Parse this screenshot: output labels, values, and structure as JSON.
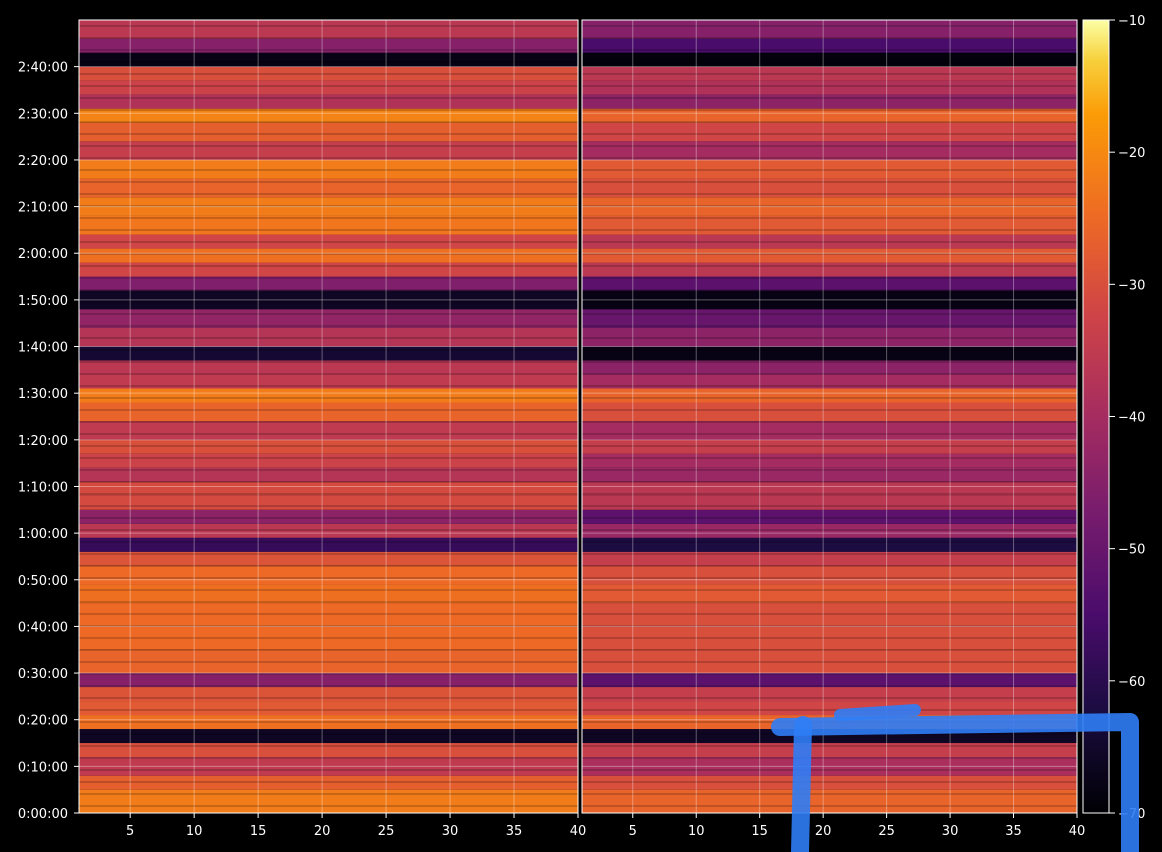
{
  "chart_data": {
    "type": "heatmap",
    "panels": [
      {
        "name": "",
        "xlim": [
          1,
          40
        ],
        "x_ticks": [
          5,
          10,
          15,
          20,
          25,
          30,
          35,
          40
        ],
        "x_tick_labels": [
          "5",
          "10",
          "15",
          "20",
          "25",
          "30",
          "35",
          "40"
        ]
      },
      {
        "name": "",
        "xlim": [
          1,
          40
        ],
        "x_ticks": [
          5,
          10,
          15,
          20,
          25,
          30,
          35,
          40
        ],
        "x_tick_labels": [
          "5",
          "10",
          "15",
          "20",
          "25",
          "30",
          "35",
          "40"
        ]
      }
    ],
    "ylim_seconds": [
      0,
      10200
    ],
    "y_ticks_seconds": [
      0,
      600,
      1200,
      1800,
      2400,
      3000,
      3600,
      4200,
      4800,
      5400,
      6000,
      6600,
      7200,
      7800,
      8400,
      9000,
      9600
    ],
    "y_tick_labels": [
      "0:00:00",
      "0:10:00",
      "0:20:00",
      "0:30:00",
      "0:40:00",
      "0:50:00",
      "1:00:00",
      "1:10:00",
      "1:20:00",
      "1:30:00",
      "1:40:00",
      "1:50:00",
      "2:00:00",
      "2:10:00",
      "2:20:00",
      "2:30:00",
      "2:40:00"
    ],
    "colorbar": {
      "colormap": "inferno",
      "range": [
        -70,
        -10
      ],
      "ticks": [
        -70,
        -60,
        -50,
        -40,
        -30,
        -20,
        -10
      ],
      "tick_labels": [
        "−70",
        "−60",
        "−50",
        "−40",
        "−30",
        "−20",
        "−10"
      ]
    },
    "xlabel": "",
    "ylabel": "",
    "title": "",
    "grid": true,
    "row_profile_note": "",
    "bands": {
      "time_seconds": [
        0,
        300,
        480,
        720,
        900,
        1080,
        1260,
        1440,
        1620,
        1800,
        2100,
        2400,
        2700,
        2940,
        3180,
        3360,
        3540,
        3720,
        3900,
        4080,
        4260,
        4440,
        4620,
        4800,
        5040,
        5280,
        5460,
        5640,
        5820,
        6000,
        6240,
        6480,
        6720,
        6900,
        7080,
        7260,
        7440,
        7680,
        7920,
        8160,
        8400,
        8640,
        8880,
        9060,
        9240,
        9420,
        9600,
        9780,
        9960,
        10200
      ],
      "left_values_db": [
        -22,
        -27,
        -35,
        -30,
        -66,
        -24,
        -28,
        -29,
        -45,
        -26,
        -25,
        -25,
        -24,
        -25,
        -29,
        -58,
        -36,
        -44,
        -31,
        -31,
        -37,
        -33,
        -30,
        -35,
        -26,
        -22,
        -35,
        -36,
        -64,
        -37,
        -43,
        -66,
        -46,
        -32,
        -24,
        -32,
        -23,
        -22,
        -26,
        -22,
        -34,
        -27,
        -21,
        -38,
        -33,
        -30,
        -68,
        -45,
        -36,
        -28
      ],
      "right_values_db": [
        -26,
        -30,
        -39,
        -34,
        -66,
        -26,
        -32,
        -34,
        -52,
        -30,
        -30,
        -30,
        -28,
        -30,
        -34,
        -62,
        -42,
        -52,
        -36,
        -36,
        -42,
        -40,
        -34,
        -40,
        -30,
        -26,
        -40,
        -44,
        -68,
        -44,
        -50,
        -68,
        -52,
        -36,
        -28,
        -36,
        -28,
        -26,
        -30,
        -28,
        -40,
        -32,
        -26,
        -44,
        -38,
        -36,
        -69,
        -55,
        -45,
        -32
      ]
    }
  },
  "overlay": {
    "annotation_color": "#2f7df6"
  }
}
